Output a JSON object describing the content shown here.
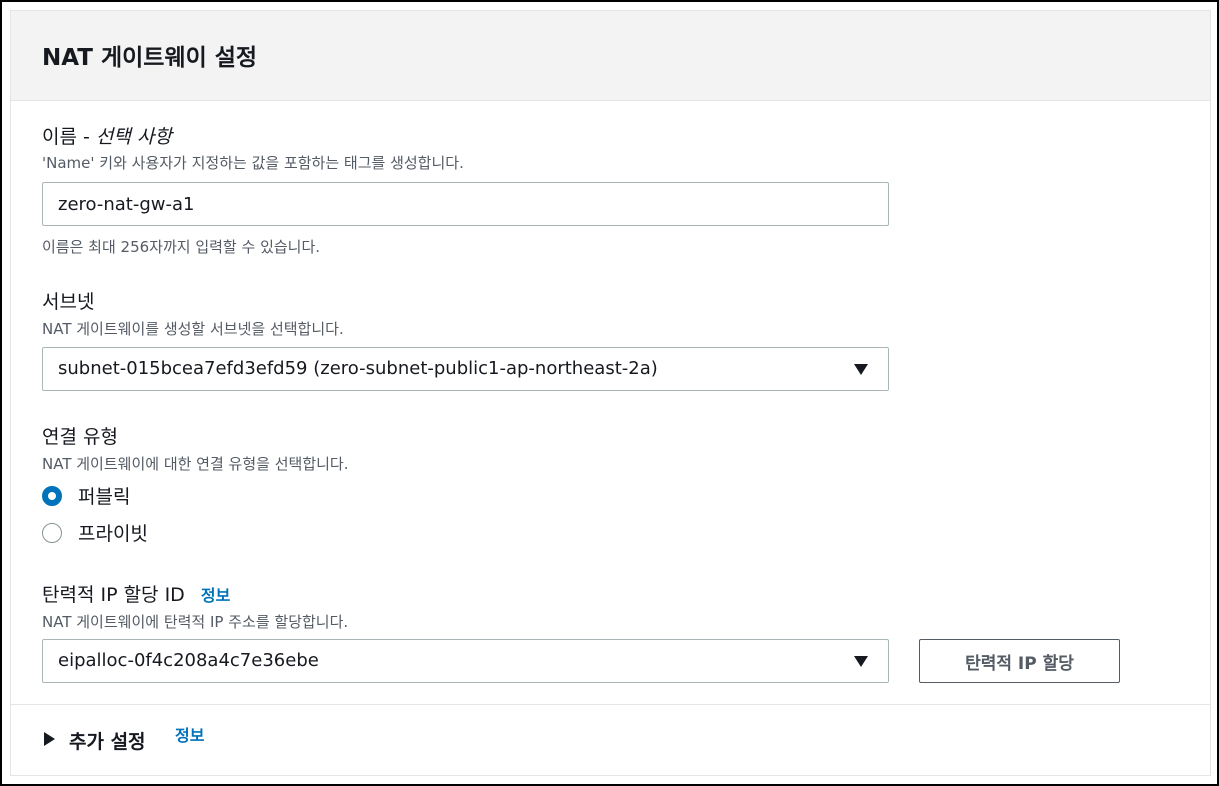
{
  "panel": {
    "title": "NAT 게이트웨이 설정"
  },
  "name_field": {
    "label": "이름 - ",
    "label_optional": "선택 사항",
    "description": "'Name' 키와 사용자가 지정하는 값을 포함하는 태그를 생성합니다.",
    "value": "zero-nat-gw-a1",
    "hint": "이름은 최대 256자까지 입력할 수 있습니다."
  },
  "subnet_field": {
    "label": "서브넷",
    "description": "NAT 게이트웨이를 생성할 서브넷을 선택합니다.",
    "selected": "subnet-015bcea7efd3efd59 (zero-subnet-public1-ap-northeast-2a)"
  },
  "connectivity": {
    "label": "연결 유형",
    "description": "NAT 게이트웨이에 대한 연결 유형을 선택합니다.",
    "options": [
      {
        "label": "퍼블릭",
        "checked": true
      },
      {
        "label": "프라이빗",
        "checked": false
      }
    ]
  },
  "eip_field": {
    "label": "탄력적 IP 할당 ID",
    "info_link": "정보",
    "description": "NAT 게이트웨이에 탄력적 IP 주소를 할당합니다.",
    "selected": "eipalloc-0f4c208a4c7e36ebe",
    "allocate_button": "탄력적 IP 할당"
  },
  "additional_settings": {
    "label": "추가 설정",
    "info_link": "정보",
    "expanded": false
  },
  "colors": {
    "accent": "#0073bb",
    "header_bg": "#f3f3f3",
    "border": "#aab7b8",
    "text": "#16191f",
    "muted": "#545b64"
  },
  "icons": {
    "select_caret": "caret-down-icon",
    "expander": "caret-right-icon"
  }
}
